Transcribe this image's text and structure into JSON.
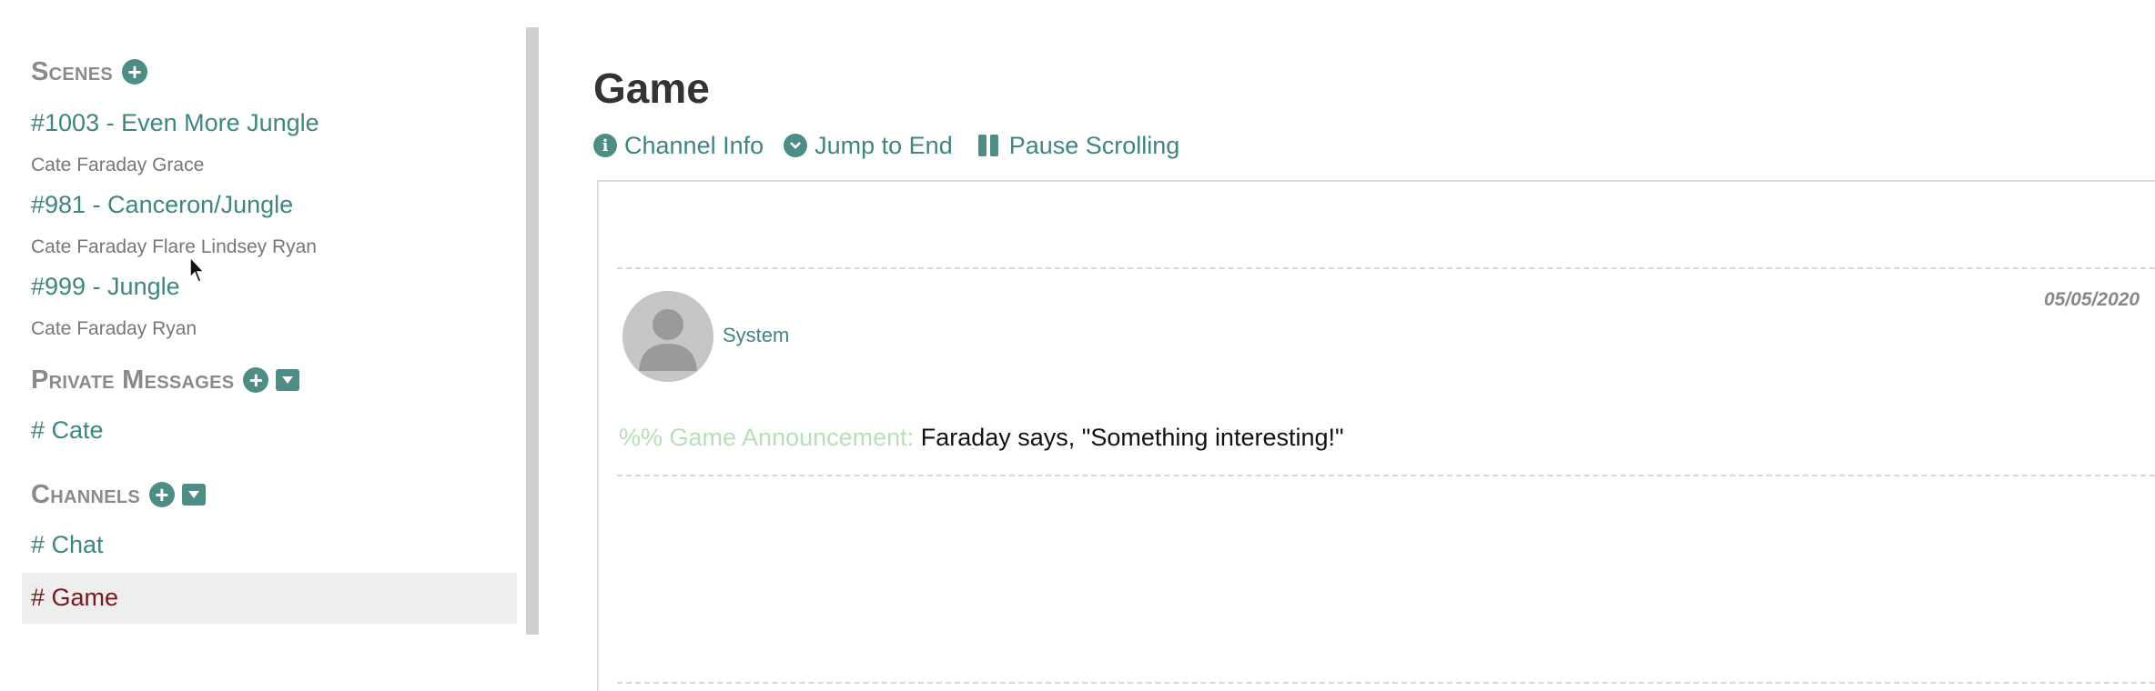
{
  "sidebar": {
    "scenes_header": "Scenes",
    "scenes": [
      {
        "title": "#1003 - Even More Jungle",
        "people": "Cate Faraday Grace"
      },
      {
        "title": "#981 - Canceron/Jungle",
        "people": "Cate Faraday Flare Lindsey Ryan"
      },
      {
        "title": "#999 - Jungle",
        "people": "Cate Faraday Ryan"
      }
    ],
    "pm_header": "Private Messages",
    "private_messages": [
      "# Cate"
    ],
    "channels_header": "Channels",
    "channels": [
      "# Chat",
      "# Game"
    ],
    "active_channel": "# Game"
  },
  "main": {
    "title": "Game",
    "toolbar": {
      "channel_info": "Channel Info",
      "jump_to_end": "Jump to End",
      "pause_scrolling": "Pause Scrolling"
    },
    "messages": [
      {
        "author": "System",
        "date": "05/05/2020",
        "prefix": "%% Game Announcement:",
        "text": "Faraday says, \"Something interesting!\""
      }
    ]
  },
  "icons": {
    "add": "plus-circle-icon",
    "collapse": "caret-down-icon",
    "info": "info-circle-icon",
    "jump": "chevron-circle-down-icon",
    "pause": "pause-icon",
    "avatar": "default-user-icon"
  },
  "colors": {
    "accent": "#3f8580",
    "icon_bg": "#4e8c86",
    "active_channel_text": "#7a1822",
    "announcement_prefix": "#b9deb9",
    "section_header": "#8a8a8a"
  }
}
